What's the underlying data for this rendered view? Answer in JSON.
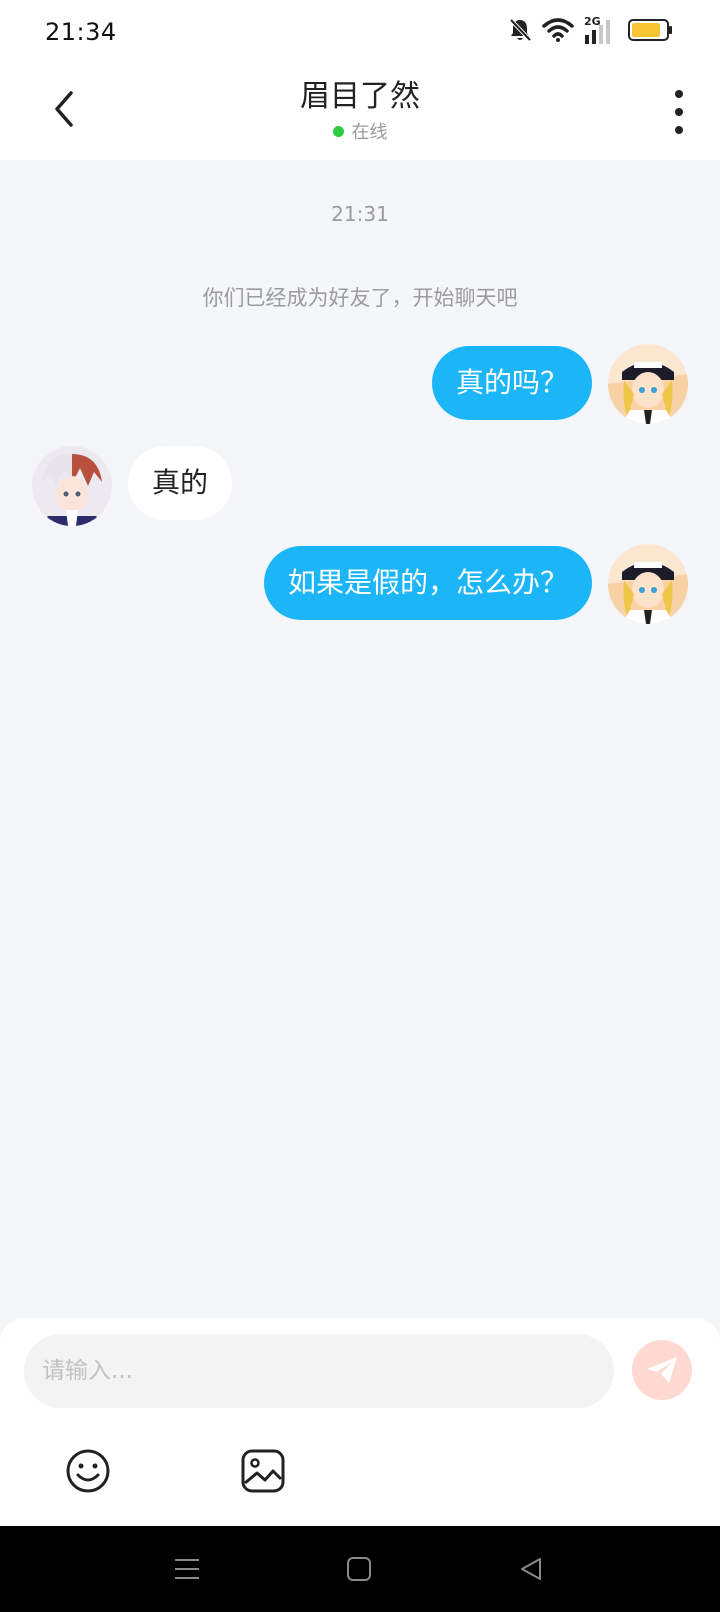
{
  "status_bar": {
    "time": "21:34",
    "network": "2G",
    "icons": [
      "bell-muted-icon",
      "wifi-icon",
      "cellular-signal-icon",
      "battery-icon"
    ],
    "battery_color": "#f7c533"
  },
  "header": {
    "title": "眉目了然",
    "status_text": "在线",
    "status_color": "#2ecc40",
    "back_icon": "back-arrow-icon",
    "more_icon": "more-vertical-icon"
  },
  "chat": {
    "timestamp": "21:31",
    "system_message": "你们已经成为好友了，开始聊天吧",
    "messages": [
      {
        "direction": "sent",
        "text": "真的吗？"
      },
      {
        "direction": "received",
        "text": "真的"
      },
      {
        "direction": "sent",
        "text": "如果是假的，怎么办？"
      }
    ],
    "sent_bubble_color": "#1cb5f8",
    "received_bubble_color": "#ffffff"
  },
  "composer": {
    "placeholder": "请输入...",
    "value": "",
    "send_icon": "paper-plane-icon",
    "tools": [
      "emoji-icon",
      "image-icon"
    ]
  },
  "system_nav": {
    "buttons": [
      "menu-icon",
      "home-icon",
      "back-triangle-icon"
    ]
  }
}
